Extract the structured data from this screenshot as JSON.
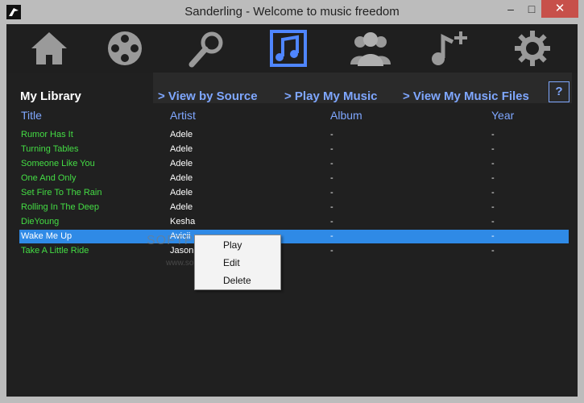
{
  "window": {
    "title": "Sanderling - Welcome to music freedom",
    "min": "–",
    "max": "□",
    "close": "✕"
  },
  "toolbar": {
    "items": [
      {
        "name": "home-icon"
      },
      {
        "name": "source-icon"
      },
      {
        "name": "search-icon"
      },
      {
        "name": "music-icon"
      },
      {
        "name": "users-icon"
      },
      {
        "name": "add-music-icon"
      },
      {
        "name": "settings-icon"
      }
    ],
    "active_color": "#4f86ff",
    "icon_color": "#9a9a9a"
  },
  "library": {
    "title": "My Library",
    "links": [
      "> View by Source",
      "> Play My Music",
      "> View My Music Files"
    ],
    "help": "?",
    "columns": [
      "Title",
      "Artist",
      "Album",
      "Year"
    ],
    "rows": [
      {
        "title": "Rumor Has It",
        "artist": "Adele",
        "album": "-",
        "year": "-"
      },
      {
        "title": "Turning Tables",
        "artist": "Adele",
        "album": "-",
        "year": "-"
      },
      {
        "title": "Someone Like You",
        "artist": "Adele",
        "album": "-",
        "year": "-"
      },
      {
        "title": "One And Only",
        "artist": "Adele",
        "album": "-",
        "year": "-"
      },
      {
        "title": "Set Fire To The Rain",
        "artist": "Adele",
        "album": "-",
        "year": "-"
      },
      {
        "title": "Rolling In The Deep",
        "artist": "Adele",
        "album": "-",
        "year": "-"
      },
      {
        "title": "DieYoung",
        "artist": "Kesha",
        "album": "-",
        "year": "-"
      },
      {
        "title": "Wake Me Up",
        "artist": "Avicii",
        "album": "-",
        "year": "-"
      },
      {
        "title": "Take A Little Ride",
        "artist": "Jason",
        "album": "-",
        "year": "-"
      }
    ]
  },
  "context_menu": {
    "items": [
      "Play",
      "Edit",
      "Delete"
    ]
  },
  "watermark": {
    "text": "SOFTPEDIA",
    "url": "www.softpedia.com"
  }
}
